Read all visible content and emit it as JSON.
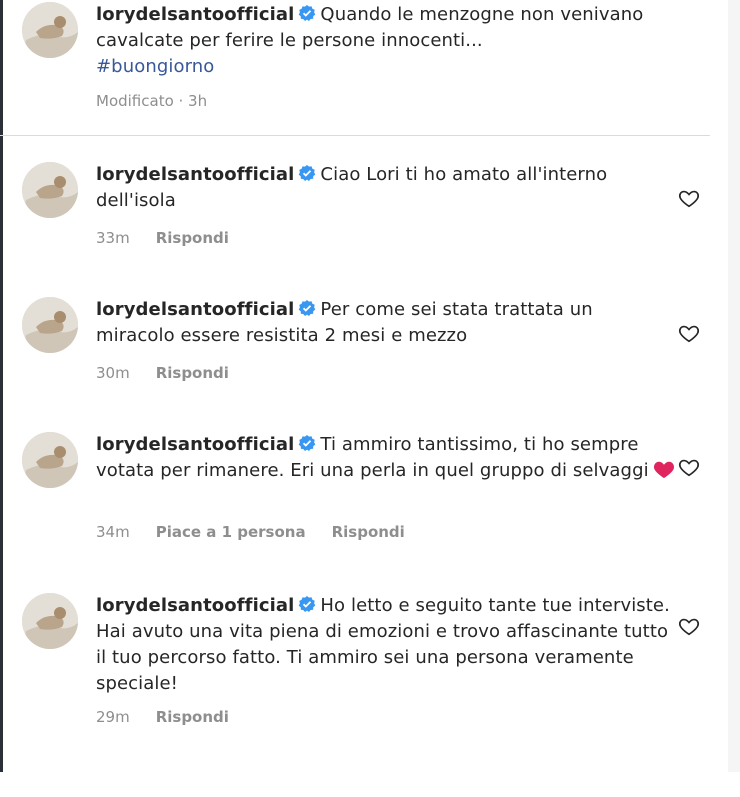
{
  "caption": {
    "username": "lorydelsantoofficial",
    "text": "Quando le menzogne non venivano cavalcate per ferire le persone innocenti...",
    "hashtag": "#buongiorno",
    "meta": "Modificato · 3h"
  },
  "comments": [
    {
      "username": "lorydelsantoofficial",
      "text": "Ciao Lori ti ho amato all'interno dell'isola",
      "time": "33m",
      "reply_label": "Rispondi"
    },
    {
      "username": "lorydelsantoofficial",
      "text": "Per come sei stata trattata un miracolo essere resistita 2 mesi e mezzo",
      "time": "30m",
      "reply_label": "Rispondi"
    },
    {
      "username": "lorydelsantoofficial",
      "text": "Ti ammiro tantissimo, ti ho sempre votata per rimanere. Eri una perla in quel gruppo di selvaggi",
      "emoji": "red-heart",
      "time": "34m",
      "likes_label": "Piace a 1 persona",
      "reply_label": "Rispondi"
    },
    {
      "username": "lorydelsantoofficial",
      "text": "Ho letto e seguito tante tue interviste. Hai avuto una vita piena di emozioni e trovo affascinante tutto il tuo percorso fatto. Ti ammiro sei una persona veramente speciale!",
      "time": "29m",
      "reply_label": "Rispondi"
    }
  ],
  "colors": {
    "verified": "#3897f0",
    "hashtag": "#385898",
    "meta_text": "#8e8e8e",
    "emoji_heart": "#e0245e"
  },
  "icons": [
    "avatar",
    "verified-badge-icon",
    "heart-outline-icon",
    "red-heart-emoji"
  ]
}
